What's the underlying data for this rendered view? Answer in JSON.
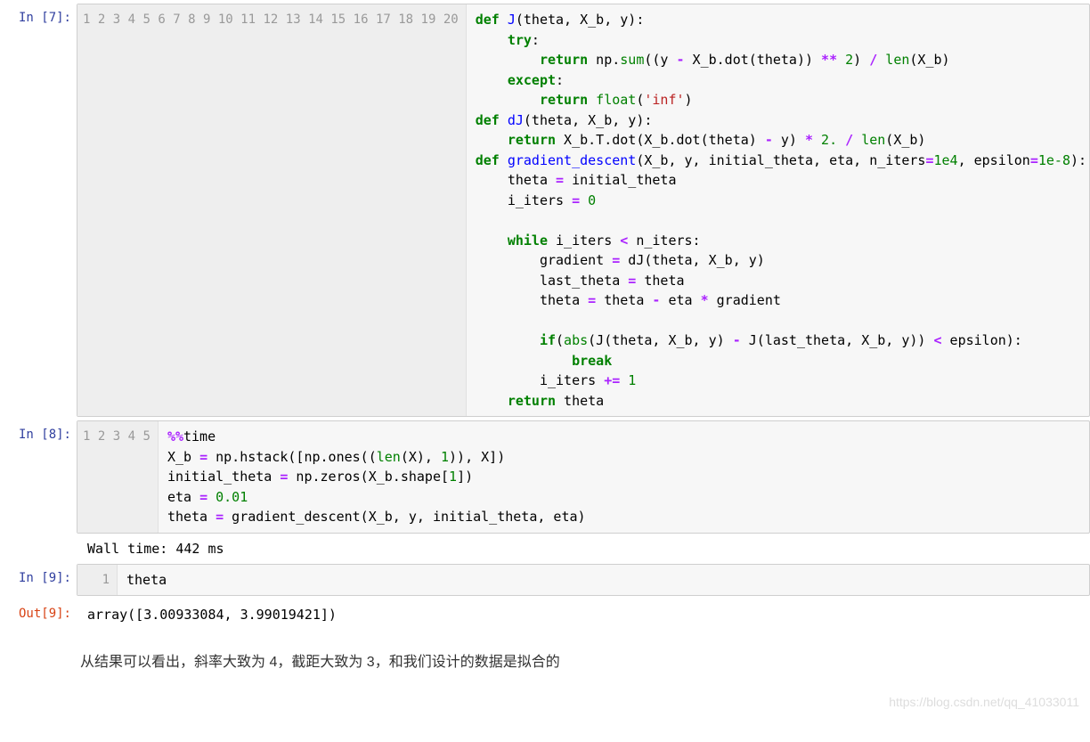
{
  "cells": {
    "c7": {
      "prompt": "In  [7]:",
      "line_numbers": [
        "1",
        "2",
        "3",
        "4",
        "5",
        "6",
        "7",
        "8",
        "9",
        "10",
        "11",
        "12",
        "13",
        "14",
        "15",
        "16",
        "17",
        "18",
        "19",
        "20"
      ]
    },
    "c8": {
      "prompt": "In  [8]:",
      "line_numbers": [
        "1",
        "2",
        "3",
        "4",
        "5"
      ],
      "output": "Wall time: 442 ms"
    },
    "c9": {
      "prompt": "In  [9]:",
      "line_numbers": [
        "1"
      ],
      "code_text": "theta",
      "out_prompt": "Out[9]:",
      "out_value": "array([3.00933084, 3.99019421])"
    }
  },
  "commentary": "从结果可以看出，斜率大致为 4，截距大致为 3，和我们设计的数据是拟合的",
  "watermark": "https://blog.csdn.net/qq_41033011",
  "code7": {
    "l1": {
      "def": "def",
      "name": "J",
      "rest": "(theta, X_b, y):"
    },
    "l2": {
      "try": "try",
      "colon": ":"
    },
    "l3": {
      "ret": "return",
      "np": " np.",
      "sum": "sum",
      "p1": "((y ",
      "minus": "-",
      "p2": " X_b.dot(theta)) ",
      "pow": "**",
      "sp": " ",
      "two": "2",
      "p3": ") ",
      "div": "/",
      "sp2": " ",
      "len": "len",
      "p4": "(X_b)"
    },
    "l4": {
      "exc": "except",
      "colon": ":"
    },
    "l5": {
      "ret": "return",
      "sp": " ",
      "flt": "float",
      "p1": "(",
      "s": "'inf'",
      "p2": ")"
    },
    "l6": {
      "def": "def",
      "name": "dJ",
      "rest": "(theta, X_b, y):"
    },
    "l7": {
      "ret": "return",
      "p1": " X_b.T.dot(X_b.dot(theta) ",
      "minus": "-",
      "p2": " y) ",
      "star": "*",
      "sp": " ",
      "two": "2.",
      "sp2": " ",
      "div": "/",
      "sp3": " ",
      "len": "len",
      "p3": "(X_b)"
    },
    "l8": {
      "def": "def",
      "name": "gradient_descent",
      "p1": "(X_b, y, initial_theta, eta, n_iters",
      "eq1": "=",
      "v1": "1e4",
      "c": ", epsilon",
      "eq2": "=",
      "v2": "1e-8",
      "p2": "):"
    },
    "l9": {
      "t": "theta ",
      "eq": "=",
      "r": " initial_theta"
    },
    "l10": {
      "t": "i_iters ",
      "eq": "=",
      "sp": " ",
      "z": "0"
    },
    "l11": {
      "blank": ""
    },
    "l12": {
      "wh": "while",
      "p1": " i_iters ",
      "lt": "<",
      "p2": " n_iters:"
    },
    "l13": {
      "t": "gradient ",
      "eq": "=",
      "r": " dJ(theta, X_b, y)"
    },
    "l14": {
      "t": "last_theta ",
      "eq": "=",
      "r": " theta"
    },
    "l15": {
      "t": "theta ",
      "eq": "=",
      "m": " theta ",
      "minus": "-",
      "m2": " eta ",
      "star": "*",
      "r": " gradient"
    },
    "l16": {
      "blank": ""
    },
    "l17": {
      "ifk": "if",
      "p1": "(",
      "abs": "abs",
      "p2": "(J(theta, X_b, y) ",
      "minus": "-",
      "p3": " J(last_theta, X_b, y)) ",
      "lt": "<",
      "p4": " epsilon):"
    },
    "l18": {
      "brk": "break"
    },
    "l19": {
      "t": "i_iters ",
      "pe": "+=",
      "sp": " ",
      "one": "1"
    },
    "l20": {
      "ret": "return",
      "r": " theta"
    }
  },
  "code8": {
    "l1": {
      "mag": "%%",
      "t": "time"
    },
    "l2": {
      "a": "X_b ",
      "eq": "=",
      "b": " np.hstack([np.ones((",
      "len": "len",
      "c": "(X), ",
      "one": "1",
      "d": ")), X])"
    },
    "l3": {
      "a": "initial_theta ",
      "eq": "=",
      "b": " np.zeros(X_b.shape[",
      "one": "1",
      "c": "])"
    },
    "l4": {
      "a": "eta ",
      "eq": "=",
      "sp": " ",
      "v": "0.01"
    },
    "l5": {
      "a": "theta ",
      "eq": "=",
      "b": " gradient_descent(X_b, y, initial_theta, eta)"
    }
  }
}
